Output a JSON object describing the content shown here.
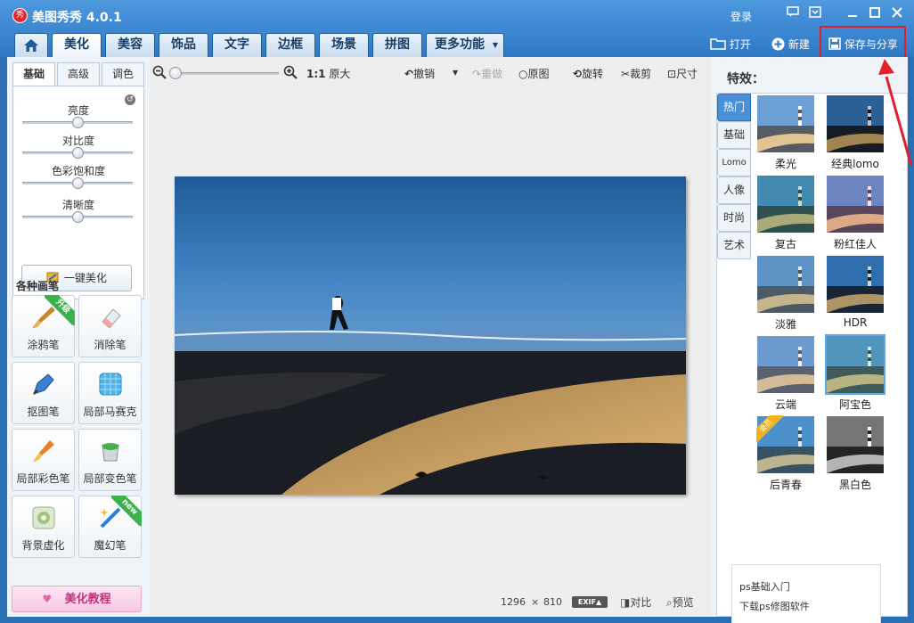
{
  "app": {
    "logo_text": "秀",
    "title": "美图秀秀 4.0.1",
    "login": "登录"
  },
  "nav": {
    "home_icon": "home-icon",
    "tabs": [
      "美化",
      "美容",
      "饰品",
      "文字",
      "边框",
      "场景",
      "拼图",
      "更多功能"
    ],
    "active_tab": "美化",
    "open": "打开",
    "new": "新建",
    "save_share": "保存与分享"
  },
  "left": {
    "sub_tabs": [
      "基础",
      "高级",
      "调色"
    ],
    "sliders": [
      {
        "label": "亮度",
        "level": 0.5
      },
      {
        "label": "对比度",
        "level": 0.5
      },
      {
        "label": "色彩饱和度",
        "level": 0.5
      },
      {
        "label": "清晰度",
        "level": 0.5
      }
    ],
    "one_click": "一键美化",
    "brush_title": "各种画笔",
    "tools": [
      {
        "label": "涂鸦笔",
        "icon": "brush-icon",
        "ribbon": "升级"
      },
      {
        "label": "消除笔",
        "icon": "eraser-icon",
        "ribbon": ""
      },
      {
        "label": "抠图笔",
        "icon": "cutout-pen-icon",
        "ribbon": ""
      },
      {
        "label": "局部马赛克",
        "icon": "mosaic-icon",
        "ribbon": ""
      },
      {
        "label": "局部彩色笔",
        "icon": "color-brush-icon",
        "ribbon": ""
      },
      {
        "label": "局部变色笔",
        "icon": "recolor-icon",
        "ribbon": ""
      },
      {
        "label": "背景虚化",
        "icon": "blur-icon",
        "ribbon": ""
      },
      {
        "label": "魔幻笔",
        "icon": "magic-pen-icon",
        "ribbon": "new"
      }
    ],
    "tutorial": "美化教程"
  },
  "toolbar": {
    "zoom_actual": "1:1",
    "original_size": "原大",
    "undo": "撤销",
    "redo": "重做",
    "original": "原图",
    "rotate": "旋转",
    "crop": "裁剪",
    "size": "尺寸"
  },
  "status": {
    "width": "1296",
    "times": "×",
    "height": "810",
    "exif": "EXIF▲",
    "compare": "对比",
    "preview": "预览"
  },
  "right": {
    "title": "特效：",
    "categories": [
      "热门",
      "基础",
      "Lomo",
      "人像",
      "时尚",
      "艺术"
    ],
    "active_category": "热门",
    "effects": [
      {
        "label": "柔光",
        "tint": "rgba(255,255,255,0.25)"
      },
      {
        "label": "经典lomo",
        "tint": "rgba(0,0,0,0.25)"
      },
      {
        "label": "复古",
        "tint": "rgba(80,160,140,0.35)"
      },
      {
        "label": "粉红佳人",
        "tint": "rgba(230,150,190,0.3)"
      },
      {
        "label": "淡雅",
        "tint": "rgba(160,190,200,0.35)"
      },
      {
        "label": "HDR",
        "tint": "rgba(0,40,80,0.2)"
      },
      {
        "label": "云端",
        "tint": "rgba(200,210,230,0.35)"
      },
      {
        "label": "阿宝色",
        "tint": "rgba(120,190,170,0.35)"
      },
      {
        "label": "后青春",
        "tint": "rgba(120,190,220,0.3)"
      },
      {
        "label": "黑白色",
        "tint": "grayscale"
      }
    ],
    "selected_effect": "阿宝色",
    "member_ribbon": "会员",
    "ad_lines": [
      "ps基础入门",
      "下载ps修图软件"
    ]
  },
  "colors": {
    "title_bar": "#3b86d0",
    "share_highlight": "#e0202b",
    "active_category": "#4a90d9"
  }
}
